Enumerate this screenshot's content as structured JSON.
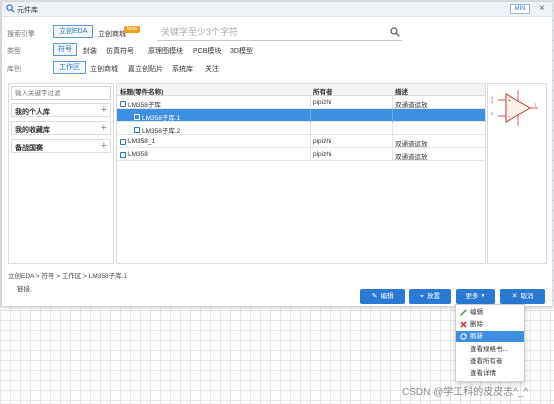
{
  "window": {
    "title": "元件库",
    "min_label": "MIN",
    "close_glyph": "×"
  },
  "filters": {
    "engine_label": "搜索引擎",
    "engines": [
      "立创EDA",
      "立创商城"
    ],
    "beta_badge": "beta",
    "search_placeholder": "关键字至少3个字符",
    "type_label": "类型",
    "types": [
      "符号",
      "封装",
      "仿真符号",
      "原理图模块",
      "PCB模块",
      "3D模型"
    ],
    "repo_label": "库别",
    "repos": [
      "工作区",
      "立创商城",
      "嘉立创贴片",
      "系统库",
      "关注"
    ]
  },
  "left_panel": {
    "filter_placeholder": "输入关键字过滤",
    "libraries": [
      {
        "label": "我的个人库"
      },
      {
        "label": "我的收藏库"
      },
      {
        "label": "备战国赛"
      }
    ]
  },
  "table": {
    "columns": [
      "标题(零件名称)",
      "所有者",
      "描述"
    ],
    "rows": [
      {
        "title": "LM358子库",
        "owner": "pipizhi",
        "desc": "双通道运放",
        "indent": 0,
        "selected": false
      },
      {
        "title": "LM358子库.1",
        "owner": "",
        "desc": "",
        "indent": 1,
        "selected": true
      },
      {
        "title": "LM358子库.2",
        "owner": "",
        "desc": "",
        "indent": 1,
        "selected": false
      },
      {
        "title": "LM358_1",
        "owner": "pipizhi",
        "desc": "双通道运放",
        "indent": 0,
        "selected": false
      },
      {
        "title": "LM358",
        "owner": "pipizhi",
        "desc": "双通道运放",
        "indent": 0,
        "selected": false
      }
    ]
  },
  "preview": {
    "pins": [
      "4",
      "3",
      "2",
      "1"
    ]
  },
  "footer": {
    "breadcrumb": "立创EDA > 符号 > 工作区 > LM358子库.1",
    "link_label": "链接:"
  },
  "actions": {
    "edit": "编辑",
    "place": "放置",
    "more": "更多",
    "cancel": "取消"
  },
  "more_menu": {
    "items": [
      {
        "label": "编辑",
        "icon": "pencil-icon"
      },
      {
        "label": "删除",
        "icon": "delete-icon"
      },
      {
        "label": "刷新",
        "icon": "refresh-icon",
        "highlighted": true
      },
      {
        "label": "查看规格书...",
        "icon": ""
      },
      {
        "label": "查看所有者",
        "icon": ""
      },
      {
        "label": "查看详情",
        "icon": ""
      }
    ]
  },
  "watermark": "CSDN @学工科的皮皮志^_^",
  "colors": {
    "accent": "#2a79d2",
    "selection": "#3d8fe0",
    "beta": "#f0a020"
  }
}
